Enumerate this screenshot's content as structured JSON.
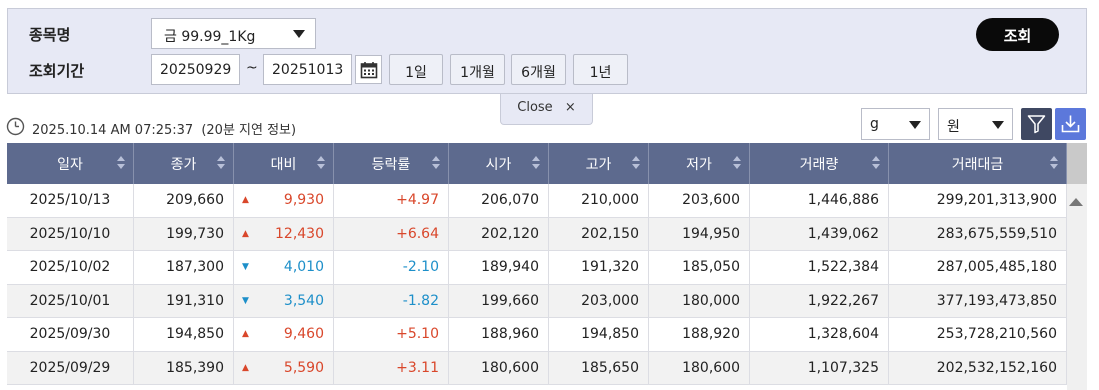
{
  "search": {
    "item_label": "종목명",
    "item_value": "금 99.99_1Kg",
    "period_label": "조회기간",
    "start_date": "20250929",
    "range_separator": "~",
    "end_date": "20251013",
    "periods": [
      "1일",
      "1개월",
      "6개월",
      "1년"
    ],
    "search_button": "조회"
  },
  "close_tab": {
    "label": "Close",
    "icon": "×"
  },
  "info": {
    "timestamp": "2025.10.14 AM 07:25:37",
    "delay_note": "(20분 지연 정보)"
  },
  "controls": {
    "unit": "g",
    "currency": "원"
  },
  "colors": {
    "up": "#d9472b",
    "down": "#1d8fc9",
    "header": "#5d6a8e",
    "search_button": "#0a0a0a",
    "download": "#5c78db"
  },
  "table": {
    "columns": [
      "일자",
      "종가",
      "대비",
      "등락률",
      "시가",
      "고가",
      "저가",
      "거래량",
      "거래대금"
    ],
    "rows": [
      {
        "date": "2025/10/13",
        "close": "209,660",
        "dir": "up",
        "arrow": "▲",
        "change": "9,930",
        "rate": "+4.97",
        "open": "206,070",
        "high": "210,000",
        "low": "203,600",
        "volume": "1,446,886",
        "amount": "299,201,313,900"
      },
      {
        "date": "2025/10/10",
        "close": "199,730",
        "dir": "up",
        "arrow": "▲",
        "change": "12,430",
        "rate": "+6.64",
        "open": "202,120",
        "high": "202,150",
        "low": "194,950",
        "volume": "1,439,062",
        "amount": "283,675,559,510"
      },
      {
        "date": "2025/10/02",
        "close": "187,300",
        "dir": "dn",
        "arrow": "▼",
        "change": "4,010",
        "rate": "-2.10",
        "open": "189,940",
        "high": "191,320",
        "low": "185,050",
        "volume": "1,522,384",
        "amount": "287,005,485,180"
      },
      {
        "date": "2025/10/01",
        "close": "191,310",
        "dir": "dn",
        "arrow": "▼",
        "change": "3,540",
        "rate": "-1.82",
        "open": "199,660",
        "high": "203,000",
        "low": "180,000",
        "volume": "1,922,267",
        "amount": "377,193,473,850"
      },
      {
        "date": "2025/09/30",
        "close": "194,850",
        "dir": "up",
        "arrow": "▲",
        "change": "9,460",
        "rate": "+5.10",
        "open": "188,960",
        "high": "194,850",
        "low": "188,920",
        "volume": "1,328,604",
        "amount": "253,728,210,560"
      },
      {
        "date": "2025/09/29",
        "close": "185,390",
        "dir": "up",
        "arrow": "▲",
        "change": "5,590",
        "rate": "+3.11",
        "open": "180,600",
        "high": "185,650",
        "low": "180,600",
        "volume": "1,107,325",
        "amount": "202,532,152,160"
      }
    ]
  }
}
